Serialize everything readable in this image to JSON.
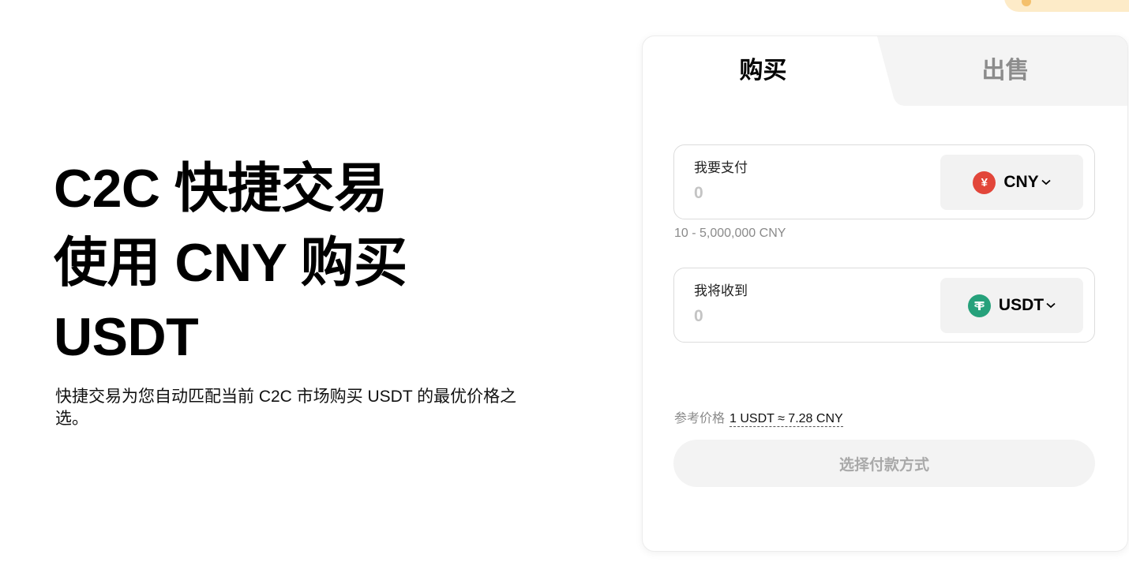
{
  "hero": {
    "title_line1": "C2C 快捷交易",
    "title_line2": "使用 CNY 购买",
    "title_line3": "USDT",
    "description": "快捷交易为您自动匹配当前 C2C 市场购买 USDT 的最优价格之选。"
  },
  "tabs": {
    "buy": "购买",
    "sell": "出售",
    "active": "buy"
  },
  "pay": {
    "label": "我要支付",
    "placeholder": "0",
    "currency": "CNY",
    "currency_icon": "yuan-icon",
    "range": "10 - 5,000,000 CNY"
  },
  "receive": {
    "label": "我将收到",
    "placeholder": "0",
    "currency": "USDT",
    "currency_icon": "tether-icon"
  },
  "reference": {
    "label": "参考价格",
    "rate": "1 USDT ≈ 7.28 CNY"
  },
  "submit_label": "选择付款方式",
  "colors": {
    "cny": "#e2463a",
    "usdt": "#26a17b",
    "sell_tab_bg": "#f4f4f4",
    "button_bg": "#f3f3f3"
  }
}
